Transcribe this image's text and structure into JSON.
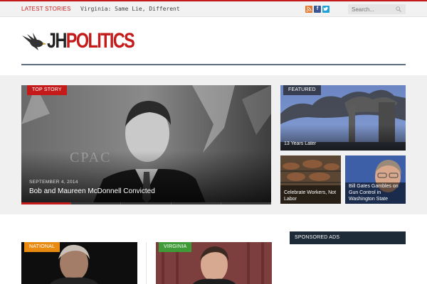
{
  "topbar": {
    "latest_label": "LATEST STORIES",
    "ticker_text": "Virginia: Same Lie, Different",
    "social": {
      "rss": "rss-icon",
      "facebook": "facebook-icon",
      "twitter": "twitter-icon"
    },
    "search_placeholder": "Search..."
  },
  "header": {
    "logo_jh": "JH",
    "logo_politics": "POLITICS"
  },
  "colors": {
    "accent_red": "#c41a1a",
    "header_rule": "#5b6d80",
    "tag_orange": "#e98a10",
    "tag_green": "#3f9b37",
    "ads_header": "#1d2a38"
  },
  "featured": {
    "main": {
      "tag": "TOP STORY",
      "date": "SEPTEMBER 4, 2014",
      "headline": "Bob and Maureen McDonnell Convicted"
    },
    "side_top": {
      "tag": "FEATURED",
      "caption": "13 Years Later"
    },
    "side_bottom_left": {
      "caption": "Celebrate Workers, Not Labor"
    },
    "side_bottom_right": {
      "caption": "Bill Gates Gambles on Gun Control in Washington State"
    }
  },
  "lower": {
    "card1": {
      "tag": "NATIONAL"
    },
    "card2": {
      "tag": "VIRGINIA"
    },
    "ads_title": "SPONSORED ADS"
  }
}
